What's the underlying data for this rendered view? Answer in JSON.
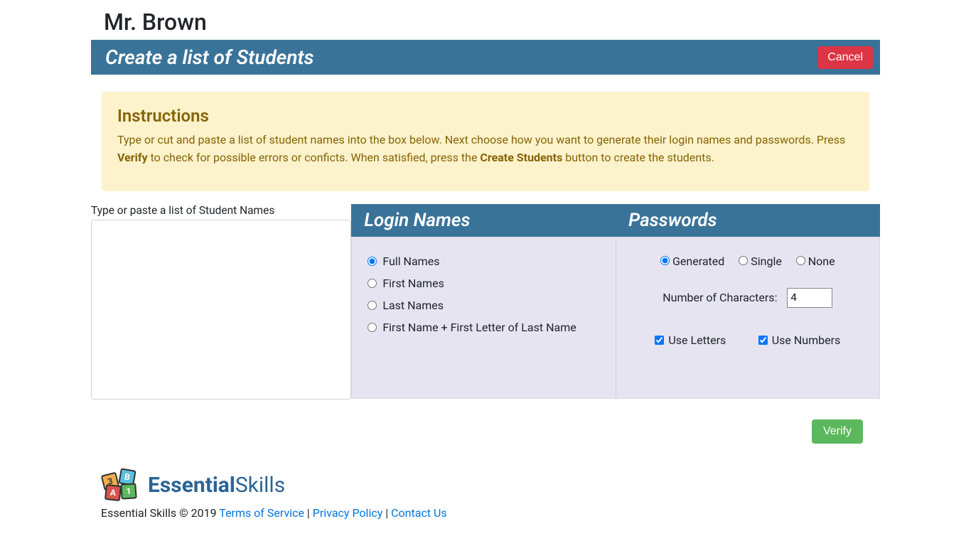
{
  "teacher_name": "Mr. Brown",
  "panel": {
    "title": "Create a list of Students",
    "cancel_label": "Cancel"
  },
  "instructions": {
    "heading": "Instructions",
    "text_1": "Type or cut and paste a list of student names into the box below. Next choose how you want to generate their login names and passwords. Press ",
    "bold_1": "Verify",
    "text_2": " to check for possible errors or conficts. When satisfied, press the ",
    "bold_2": "Create Students",
    "text_3": " button to create the students."
  },
  "names_input": {
    "label": "Type or paste a list of Student Names",
    "value": ""
  },
  "login_names": {
    "header": "Login Names",
    "options": {
      "full": "Full Names",
      "first": "First Names",
      "last": "Last Names",
      "first_plus": "First Name + First Letter of Last Name"
    },
    "selected": "full"
  },
  "passwords": {
    "header": "Passwords",
    "options": {
      "generated": "Generated",
      "single": "Single",
      "none": "None"
    },
    "selected": "generated",
    "num_chars_label": "Number of Characters:",
    "num_chars_value": "4",
    "use_letters_label": "Use Letters",
    "use_letters_checked": true,
    "use_numbers_label": "Use Numbers",
    "use_numbers_checked": true
  },
  "verify_label": "Verify",
  "footer": {
    "logo_bold": "Essential",
    "logo_light": "Skills",
    "copyright": "Essential Skills © 2019 ",
    "links": {
      "terms": "Terms of Service",
      "privacy": "Privacy Policy",
      "contact": "Contact Us"
    },
    "sep": " |"
  }
}
